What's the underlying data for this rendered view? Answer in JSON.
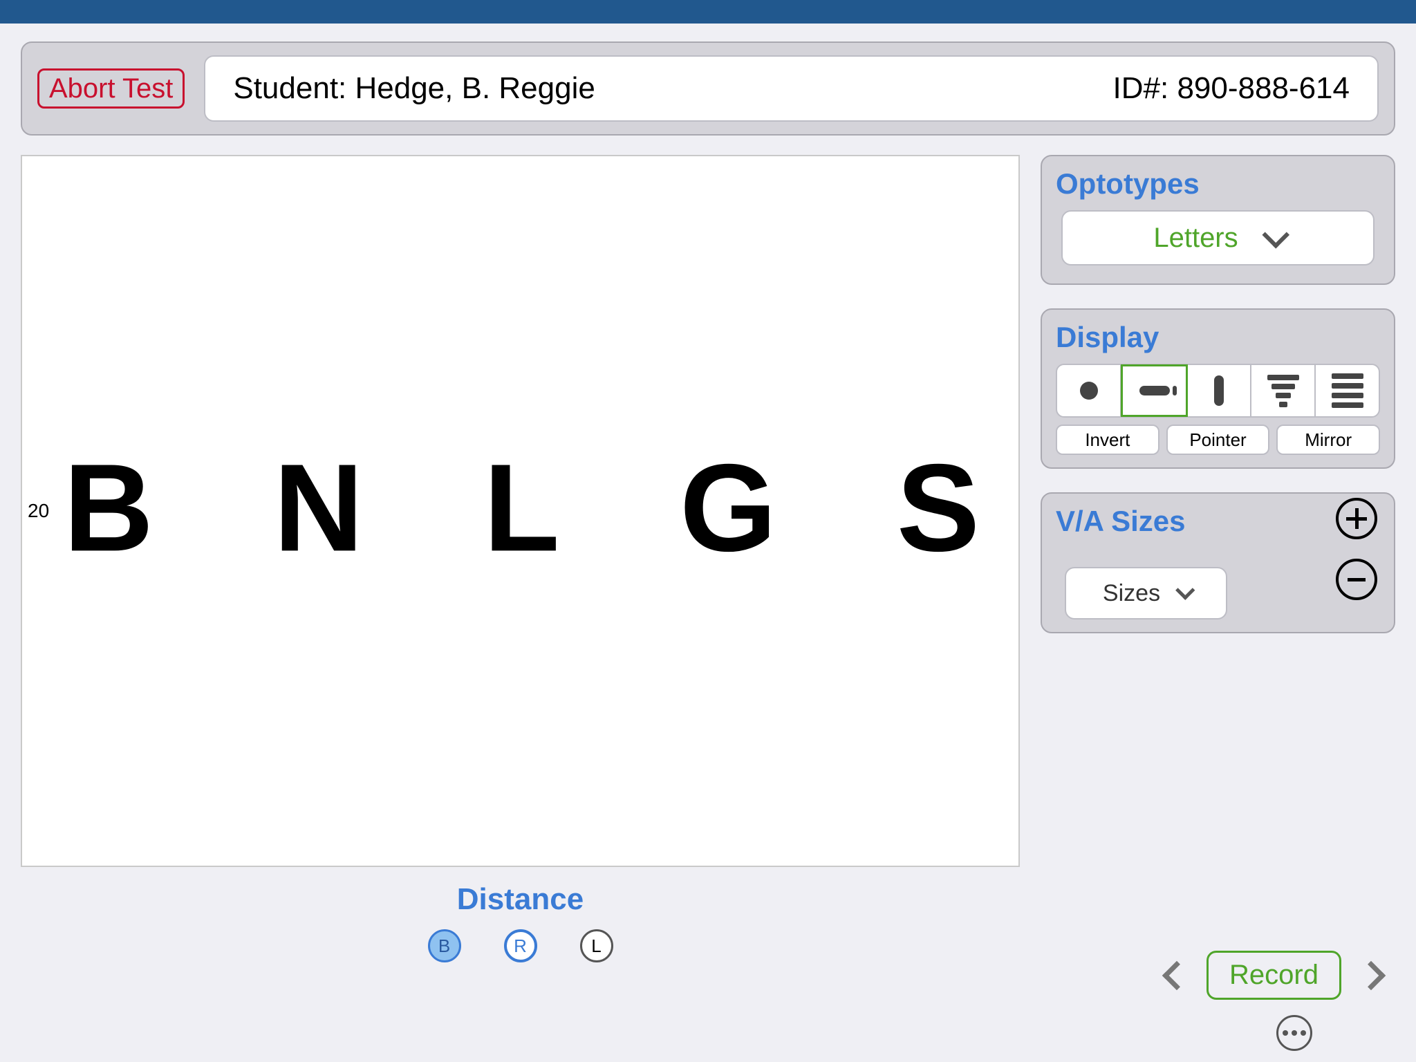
{
  "header": {
    "abort_label": "Abort Test",
    "student_label": "Student: Hedge, B. Reggie",
    "id_label": "ID#: 890-888-614"
  },
  "chart": {
    "acuity_denominator": "20",
    "letters": [
      "B",
      "N",
      "L",
      "G",
      "S"
    ]
  },
  "footer": {
    "distance_title": "Distance",
    "eyes": {
      "B": "B",
      "R": "R",
      "L": "L"
    }
  },
  "optotypes": {
    "title": "Optotypes",
    "selected": "Letters"
  },
  "display": {
    "title": "Display",
    "modes": [
      "single",
      "hline",
      "vline",
      "pyramid",
      "full"
    ],
    "selected_index": 1,
    "buttons": {
      "invert": "Invert",
      "pointer": "Pointer",
      "mirror": "Mirror"
    }
  },
  "vasizes": {
    "title": "V/A Sizes",
    "dropdown_label": "Sizes"
  },
  "nav": {
    "record_label": "Record"
  }
}
